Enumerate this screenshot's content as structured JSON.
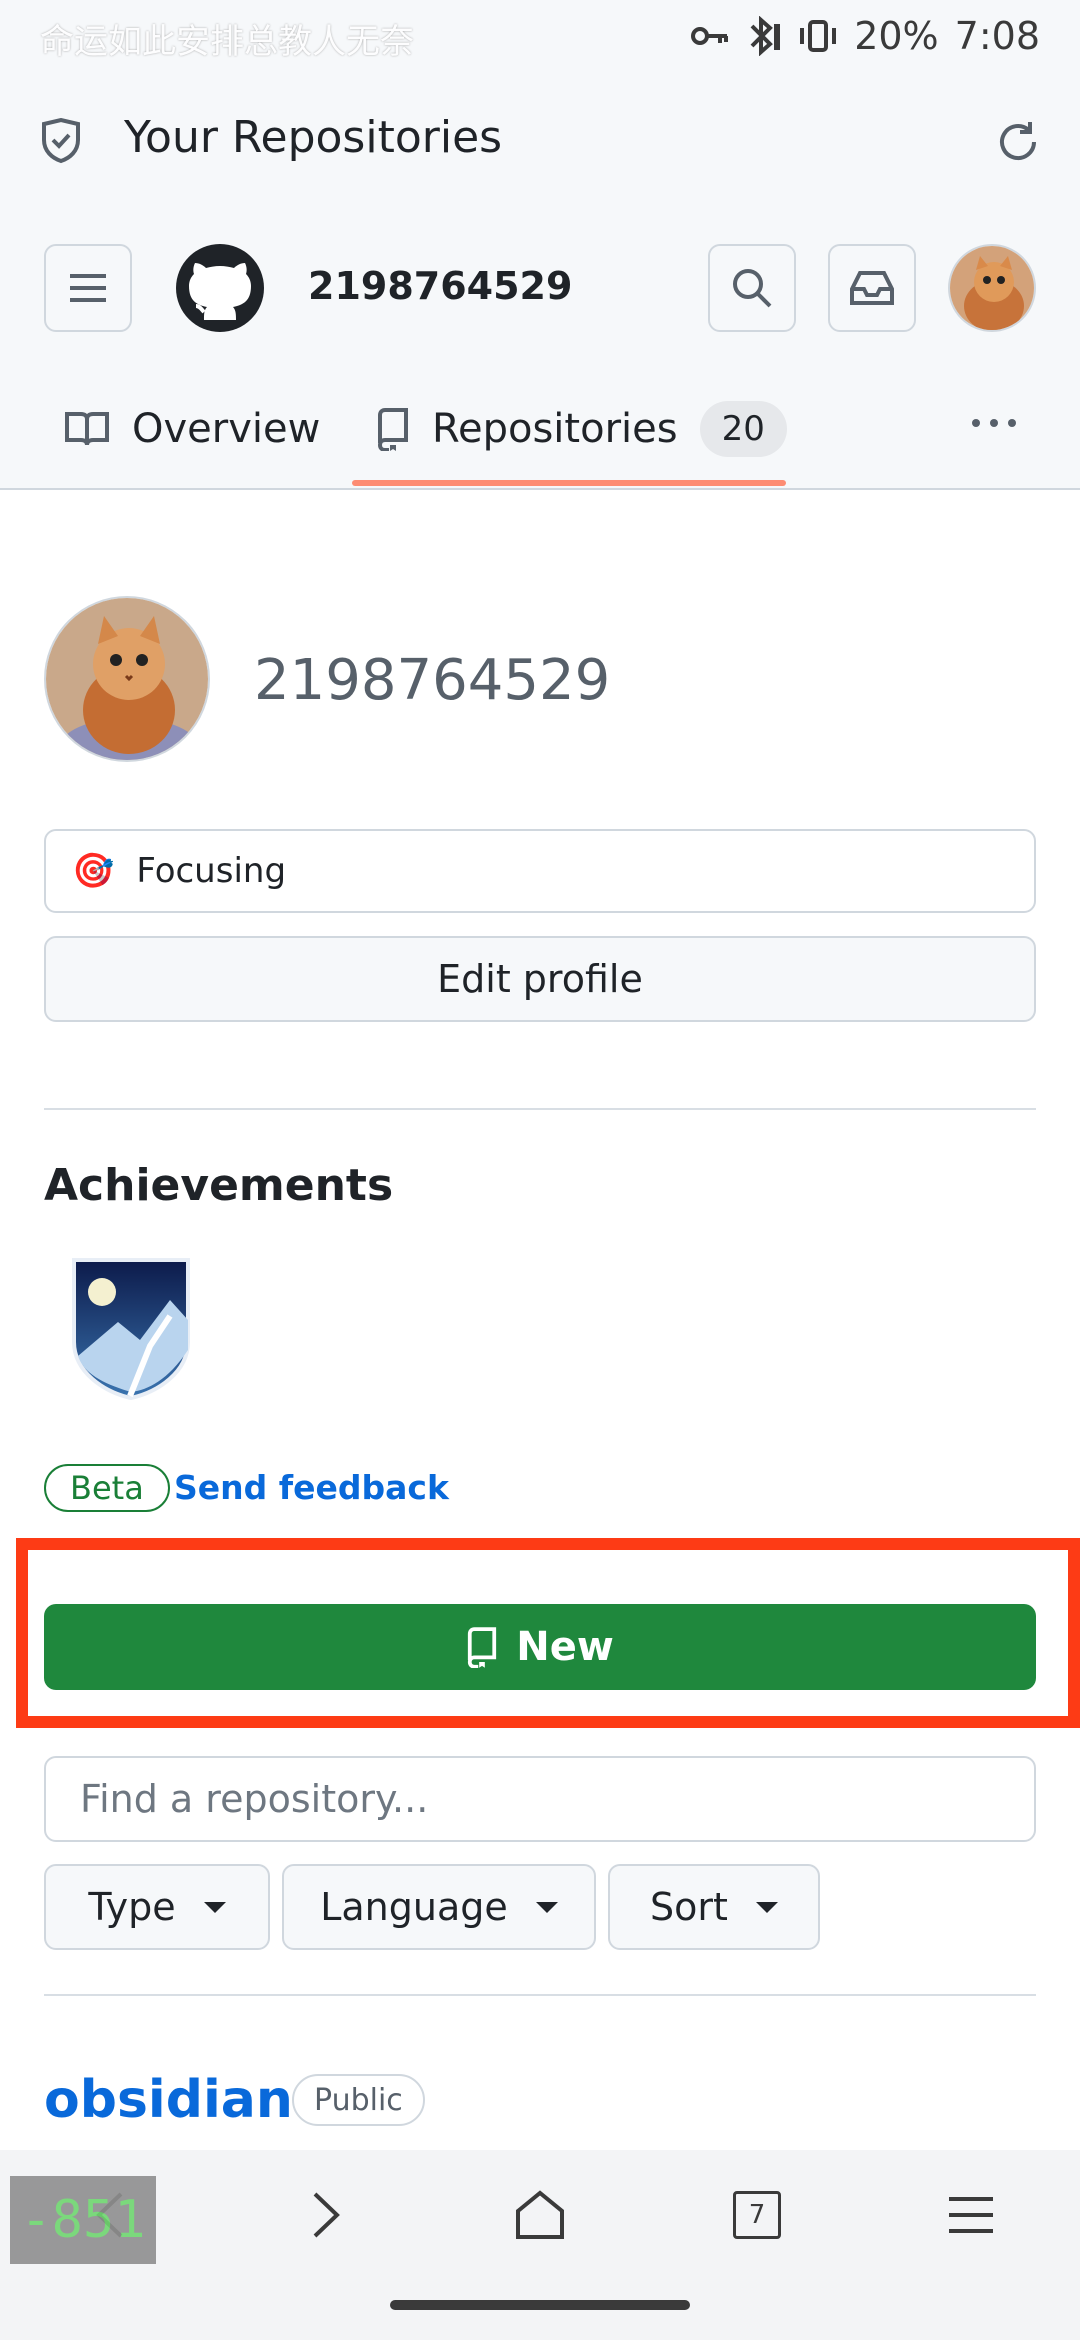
{
  "status_bar": {
    "left_text": "命运如此安排总教人无奈",
    "battery": "20%",
    "time": "7:08"
  },
  "header": {
    "title": "Your Repositories",
    "username": "2198764529"
  },
  "tabs": [
    {
      "label": "Overview"
    },
    {
      "label": "Repositories",
      "count": "20"
    }
  ],
  "profile": {
    "display_name": "2198764529",
    "status_emoji": "🎯",
    "status_text": "Focusing",
    "edit_label": "Edit profile"
  },
  "achievements": {
    "title": "Achievements",
    "beta_label": "Beta",
    "feedback_label": "Send feedback"
  },
  "repos": {
    "new_label": "New",
    "find_placeholder": "Find a repository...",
    "filters": [
      "Type",
      "Language",
      "Sort"
    ],
    "first_repo": {
      "name": "obsidian",
      "visibility": "Public"
    }
  },
  "bottom_nav": {
    "tab_count": "7",
    "overlay_value": "-851"
  },
  "colors": {
    "accent_green": "#1f883d",
    "link_blue": "#0969da",
    "tab_underline": "#fd8c73",
    "highlight_red": "#fd3b15"
  }
}
